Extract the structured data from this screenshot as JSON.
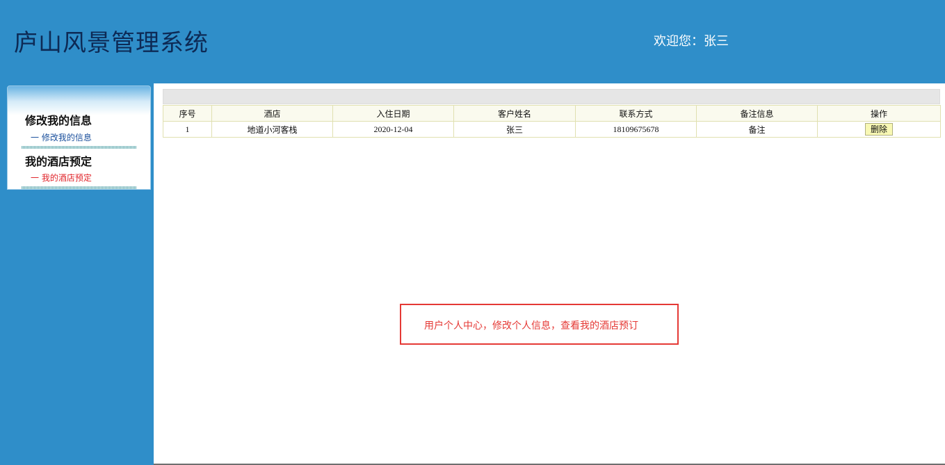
{
  "app": {
    "title": "庐山风景管理系统",
    "welcome": "欢迎您：张三"
  },
  "sidebar": {
    "sections": [
      {
        "heading": "修改我的信息",
        "link": "一 修改我的信息",
        "active": false
      },
      {
        "heading": "我的酒店预定",
        "link": "一 我的酒店预定",
        "active": true
      }
    ]
  },
  "table": {
    "columns": [
      "序号",
      "酒店",
      "入住日期",
      "客户姓名",
      "联系方式",
      "备注信息",
      "操作"
    ],
    "rows": [
      {
        "index": "1",
        "hotel": "地道小河客栈",
        "checkin_date": "2020-12-04",
        "customer_name": "张三",
        "contact": "18109675678",
        "remark": "备注",
        "action_label": "删除"
      }
    ]
  },
  "annotation": {
    "text": "用户个人中心，修改个人信息，查看我的酒店预订"
  },
  "colors": {
    "header_bg": "#2f8ec9",
    "title_color": "#0d2a55",
    "active_link": "#e0242a",
    "annotation_red": "#e53935"
  }
}
